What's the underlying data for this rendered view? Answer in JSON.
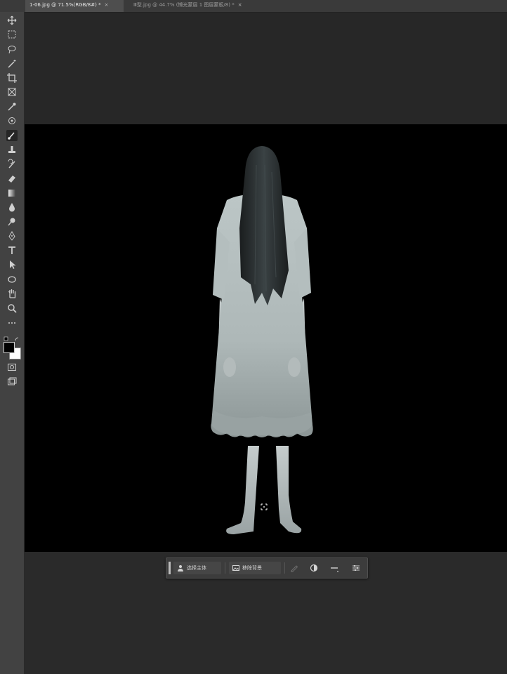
{
  "tabs": [
    {
      "label": "1-06.jpg @ 71.5%(RGB/8#) *",
      "close": "×",
      "active": true
    },
    {
      "label": "Ⅲ型.jpg @ 44.7% (懒光蒙层 1 图层蒙板/8) *",
      "close": "×",
      "active": false
    }
  ],
  "toolbar": {
    "tools": [
      "move-tool",
      "marquee-tool",
      "lasso-tool",
      "magic-wand-tool",
      "crop-tool",
      "frame-tool",
      "eyedropper-tool",
      "spot-healing-tool",
      "brush-tool",
      "clone-stamp-tool",
      "history-brush-tool",
      "eraser-tool",
      "gradient-tool",
      "blur-tool",
      "dodge-tool",
      "pen-tool",
      "type-tool",
      "path-selection-tool",
      "shape-tool",
      "hand-tool",
      "zoom-tool",
      "more-tools"
    ],
    "selected_tool": "brush-tool",
    "foreground_color": "#000000",
    "background_color": "#ffffff"
  },
  "canvas": {
    "background": "#000000",
    "subject": "long-haired figure in white dress"
  },
  "taskbar": {
    "select_subject_label": "选择主体",
    "remove_background_label": "移除背景"
  }
}
